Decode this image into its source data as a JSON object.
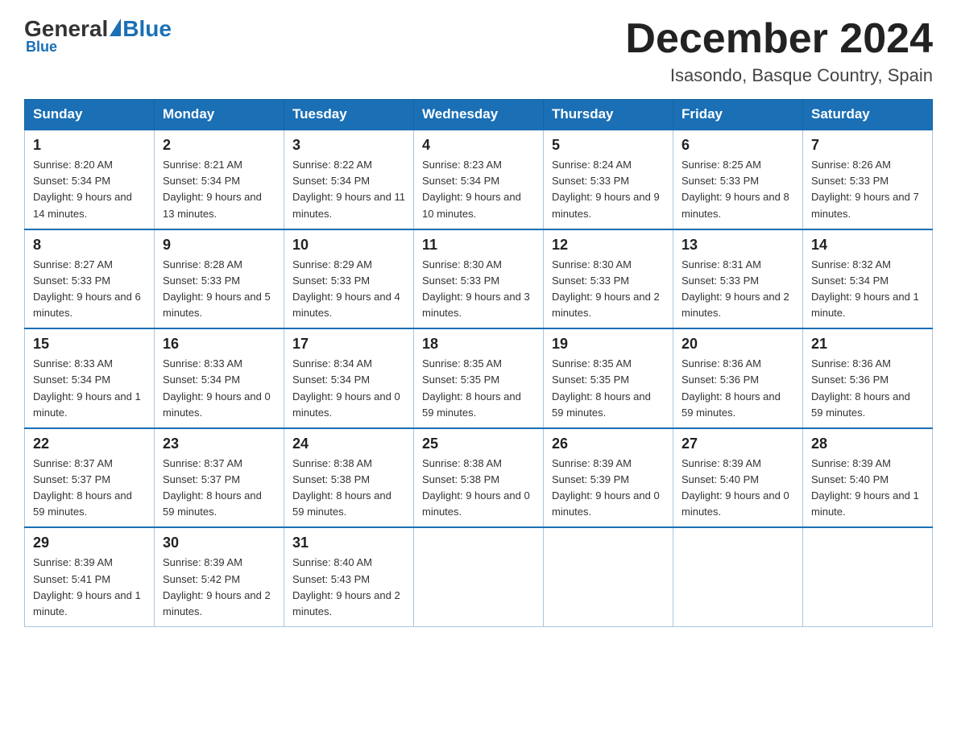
{
  "logo": {
    "general": "General",
    "blue": "Blue"
  },
  "header": {
    "title": "December 2024",
    "subtitle": "Isasondo, Basque Country, Spain"
  },
  "weekdays": [
    "Sunday",
    "Monday",
    "Tuesday",
    "Wednesday",
    "Thursday",
    "Friday",
    "Saturday"
  ],
  "weeks": [
    [
      {
        "day": "1",
        "sunrise": "8:20 AM",
        "sunset": "5:34 PM",
        "daylight": "9 hours and 14 minutes."
      },
      {
        "day": "2",
        "sunrise": "8:21 AM",
        "sunset": "5:34 PM",
        "daylight": "9 hours and 13 minutes."
      },
      {
        "day": "3",
        "sunrise": "8:22 AM",
        "sunset": "5:34 PM",
        "daylight": "9 hours and 11 minutes."
      },
      {
        "day": "4",
        "sunrise": "8:23 AM",
        "sunset": "5:34 PM",
        "daylight": "9 hours and 10 minutes."
      },
      {
        "day": "5",
        "sunrise": "8:24 AM",
        "sunset": "5:33 PM",
        "daylight": "9 hours and 9 minutes."
      },
      {
        "day": "6",
        "sunrise": "8:25 AM",
        "sunset": "5:33 PM",
        "daylight": "9 hours and 8 minutes."
      },
      {
        "day": "7",
        "sunrise": "8:26 AM",
        "sunset": "5:33 PM",
        "daylight": "9 hours and 7 minutes."
      }
    ],
    [
      {
        "day": "8",
        "sunrise": "8:27 AM",
        "sunset": "5:33 PM",
        "daylight": "9 hours and 6 minutes."
      },
      {
        "day": "9",
        "sunrise": "8:28 AM",
        "sunset": "5:33 PM",
        "daylight": "9 hours and 5 minutes."
      },
      {
        "day": "10",
        "sunrise": "8:29 AM",
        "sunset": "5:33 PM",
        "daylight": "9 hours and 4 minutes."
      },
      {
        "day": "11",
        "sunrise": "8:30 AM",
        "sunset": "5:33 PM",
        "daylight": "9 hours and 3 minutes."
      },
      {
        "day": "12",
        "sunrise": "8:30 AM",
        "sunset": "5:33 PM",
        "daylight": "9 hours and 2 minutes."
      },
      {
        "day": "13",
        "sunrise": "8:31 AM",
        "sunset": "5:33 PM",
        "daylight": "9 hours and 2 minutes."
      },
      {
        "day": "14",
        "sunrise": "8:32 AM",
        "sunset": "5:34 PM",
        "daylight": "9 hours and 1 minute."
      }
    ],
    [
      {
        "day": "15",
        "sunrise": "8:33 AM",
        "sunset": "5:34 PM",
        "daylight": "9 hours and 1 minute."
      },
      {
        "day": "16",
        "sunrise": "8:33 AM",
        "sunset": "5:34 PM",
        "daylight": "9 hours and 0 minutes."
      },
      {
        "day": "17",
        "sunrise": "8:34 AM",
        "sunset": "5:34 PM",
        "daylight": "9 hours and 0 minutes."
      },
      {
        "day": "18",
        "sunrise": "8:35 AM",
        "sunset": "5:35 PM",
        "daylight": "8 hours and 59 minutes."
      },
      {
        "day": "19",
        "sunrise": "8:35 AM",
        "sunset": "5:35 PM",
        "daylight": "8 hours and 59 minutes."
      },
      {
        "day": "20",
        "sunrise": "8:36 AM",
        "sunset": "5:36 PM",
        "daylight": "8 hours and 59 minutes."
      },
      {
        "day": "21",
        "sunrise": "8:36 AM",
        "sunset": "5:36 PM",
        "daylight": "8 hours and 59 minutes."
      }
    ],
    [
      {
        "day": "22",
        "sunrise": "8:37 AM",
        "sunset": "5:37 PM",
        "daylight": "8 hours and 59 minutes."
      },
      {
        "day": "23",
        "sunrise": "8:37 AM",
        "sunset": "5:37 PM",
        "daylight": "8 hours and 59 minutes."
      },
      {
        "day": "24",
        "sunrise": "8:38 AM",
        "sunset": "5:38 PM",
        "daylight": "8 hours and 59 minutes."
      },
      {
        "day": "25",
        "sunrise": "8:38 AM",
        "sunset": "5:38 PM",
        "daylight": "9 hours and 0 minutes."
      },
      {
        "day": "26",
        "sunrise": "8:39 AM",
        "sunset": "5:39 PM",
        "daylight": "9 hours and 0 minutes."
      },
      {
        "day": "27",
        "sunrise": "8:39 AM",
        "sunset": "5:40 PM",
        "daylight": "9 hours and 0 minutes."
      },
      {
        "day": "28",
        "sunrise": "8:39 AM",
        "sunset": "5:40 PM",
        "daylight": "9 hours and 1 minute."
      }
    ],
    [
      {
        "day": "29",
        "sunrise": "8:39 AM",
        "sunset": "5:41 PM",
        "daylight": "9 hours and 1 minute."
      },
      {
        "day": "30",
        "sunrise": "8:39 AM",
        "sunset": "5:42 PM",
        "daylight": "9 hours and 2 minutes."
      },
      {
        "day": "31",
        "sunrise": "8:40 AM",
        "sunset": "5:43 PM",
        "daylight": "9 hours and 2 minutes."
      },
      null,
      null,
      null,
      null
    ]
  ],
  "labels": {
    "sunrise": "Sunrise:",
    "sunset": "Sunset:",
    "daylight": "Daylight:"
  }
}
